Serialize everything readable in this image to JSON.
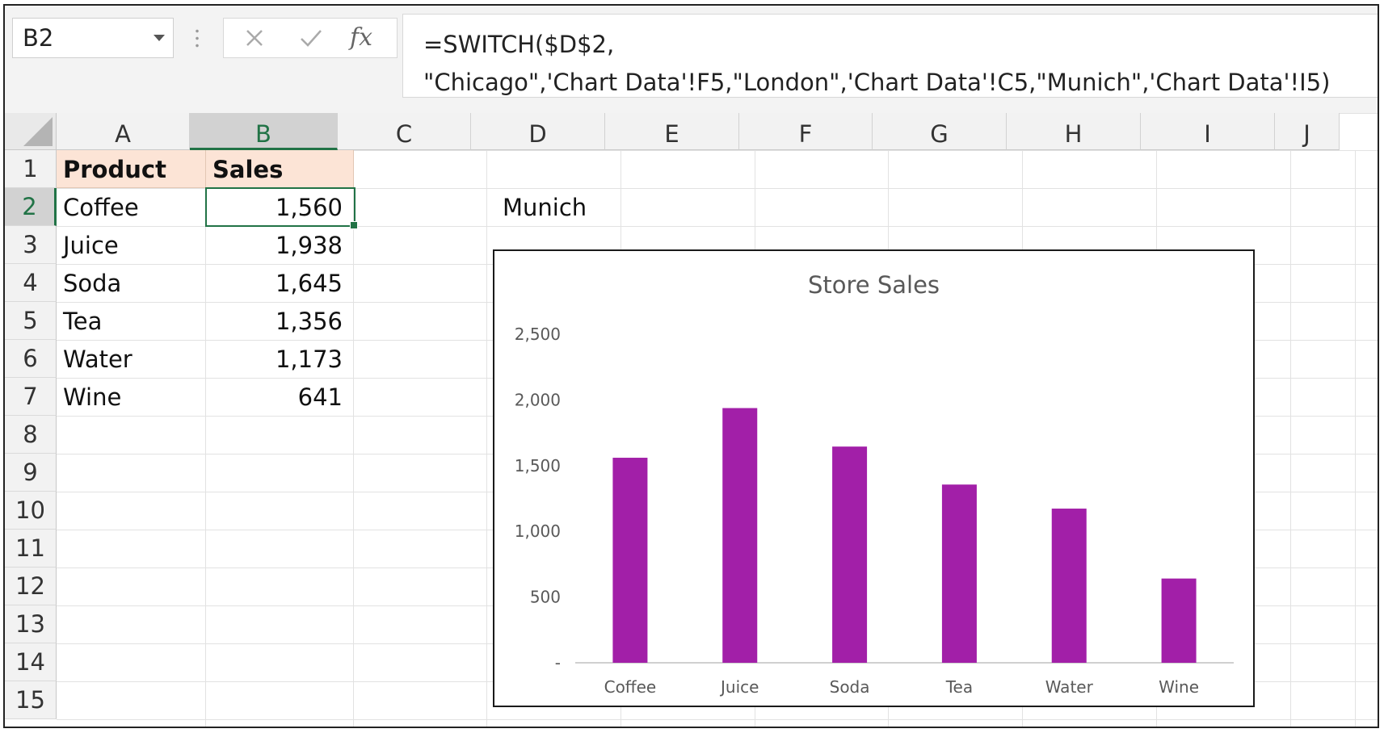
{
  "name_box": {
    "value": "B2"
  },
  "formula_bar": {
    "formula_line1": "=SWITCH($D$2,",
    "formula_line2": "\"Chicago\",'Chart Data'!F5,\"London\",'Chart Data'!C5,\"Munich\",'Chart Data'!I5)",
    "fx_label": "fx",
    "cancel_icon": "close-icon",
    "enter_icon": "check-icon"
  },
  "sheet": {
    "columns": [
      "A",
      "B",
      "C",
      "D",
      "E",
      "F",
      "G",
      "H",
      "I",
      "J"
    ],
    "selected_column": "B",
    "rows": [
      "1",
      "2",
      "3",
      "4",
      "5",
      "6",
      "7",
      "8",
      "9",
      "10",
      "11",
      "12",
      "13",
      "14",
      "15"
    ],
    "selected_row": "2",
    "header": {
      "product": "Product",
      "sales": "Sales"
    },
    "data": [
      {
        "product": "Coffee",
        "sales": "1,560"
      },
      {
        "product": "Juice",
        "sales": "1,938"
      },
      {
        "product": "Soda",
        "sales": "1,645"
      },
      {
        "product": "Tea",
        "sales": "1,356"
      },
      {
        "product": "Water",
        "sales": "1,173"
      },
      {
        "product": "Wine",
        "sales": "641"
      }
    ],
    "d2_value": "Munich"
  },
  "chart_data": {
    "type": "bar",
    "title": "Store Sales",
    "categories": [
      "Coffee",
      "Juice",
      "Soda",
      "Tea",
      "Water",
      "Wine"
    ],
    "values": [
      1560,
      1938,
      1645,
      1356,
      1173,
      641
    ],
    "ylim": [
      0,
      2500
    ],
    "yticks": [
      0,
      500,
      1000,
      1500,
      2000,
      2500
    ],
    "ytick_labels": [
      "-",
      "500",
      "1,000",
      "1,500",
      "2,000",
      "2,500"
    ],
    "bar_color": "#a21fa8",
    "grid": false,
    "legend": "none"
  },
  "colors": {
    "accent": "#217346",
    "header_fill": "#fce4d6"
  }
}
